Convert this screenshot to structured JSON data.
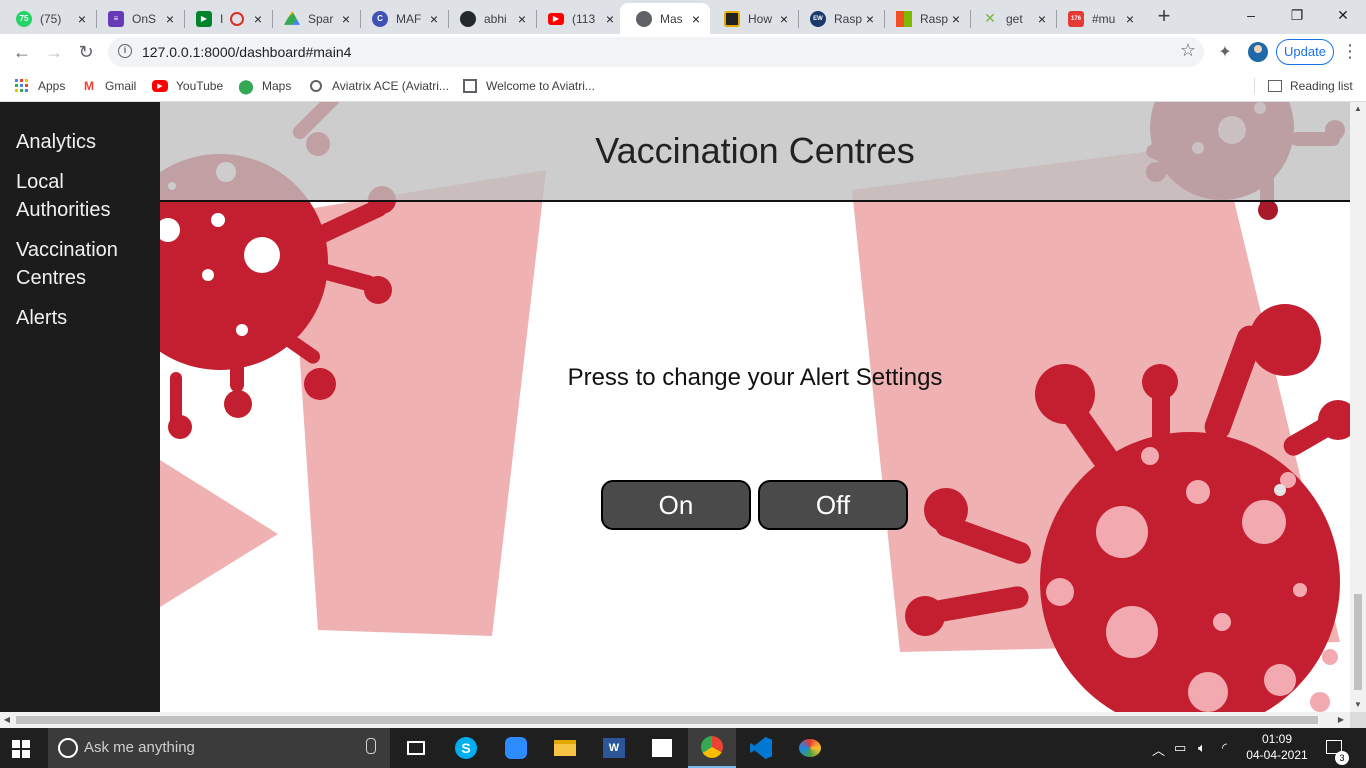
{
  "browser": {
    "tabs": [
      {
        "title": "(75)",
        "icon": "whatsapp-icon",
        "color": "#25d366",
        "badge": "75"
      },
      {
        "title": "OnS",
        "icon": "forms-icon",
        "color": "#673ab7",
        "badge": ""
      },
      {
        "title": "I",
        "icon": "meet-icon",
        "color": "#00832d",
        "badge": ""
      },
      {
        "title": "Spar",
        "icon": "drive-icon",
        "color": "#fbbc04",
        "badge": ""
      },
      {
        "title": "MAF",
        "icon": "c-icon",
        "color": "#3f51b5",
        "badge": "C"
      },
      {
        "title": "abhi",
        "icon": "github-icon",
        "color": "#24292e",
        "badge": ""
      },
      {
        "title": "(113",
        "icon": "youtube-icon",
        "color": "#ff0000",
        "badge": ""
      },
      {
        "title": "Mas",
        "icon": "globe-icon",
        "color": "#5f6368",
        "badge": ""
      },
      {
        "title": "How",
        "icon": "howto-icon",
        "color": "#e0a800",
        "badge": ""
      },
      {
        "title": "Rasp",
        "icon": "ew-icon",
        "color": "#1b3a6b",
        "badge": "EW"
      },
      {
        "title": "Rasp",
        "icon": "microsoft-icon",
        "color": "#f25022",
        "badge": ""
      },
      {
        "title": "get",
        "icon": "stackshare-icon",
        "color": "#7cb342",
        "badge": ""
      },
      {
        "title": "#mu",
        "icon": "calendar-icon",
        "color": "#e53935",
        "badge": "176"
      }
    ],
    "window_controls": {
      "minimize": "–",
      "restore": "❐",
      "close": "✕"
    },
    "new_tab": "+",
    "url": "127.0.0.1:8000/dashboard#main4",
    "update_label": "Update",
    "bookmarks": [
      {
        "label": "Apps",
        "icon": "apps-grid-icon"
      },
      {
        "label": "Gmail",
        "icon": "gmail-icon"
      },
      {
        "label": "YouTube",
        "icon": "youtube-icon"
      },
      {
        "label": "Maps",
        "icon": "maps-pin-icon"
      },
      {
        "label": "Aviatrix ACE (Aviatri...",
        "icon": "globe-icon"
      },
      {
        "label": "Welcome to Aviatri...",
        "icon": "page-icon"
      }
    ],
    "reading_list": "Reading list"
  },
  "sidebar": {
    "items": [
      {
        "label": "Analytics"
      },
      {
        "label": "Local Authorities"
      },
      {
        "label": "Vaccination Centres"
      },
      {
        "label": "Alerts"
      }
    ]
  },
  "main": {
    "title": "Vaccination Centres",
    "prompt": "Press to change your Alert Settings",
    "on_label": "On",
    "off_label": "Off"
  },
  "taskbar": {
    "search_placeholder": "Ask me anything",
    "apps": [
      "task-view-icon",
      "skype-icon",
      "zoom-icon",
      "file-explorer-icon",
      "word-icon",
      "store-icon",
      "chrome-icon",
      "vscode-icon",
      "paint-icon"
    ],
    "time": "01:09",
    "date": "04-04-2021",
    "notifications": "3"
  },
  "colors": {
    "sidebar_bg": "#1c1c1c",
    "virus_red": "#c41f30",
    "pink_shape": "#efb1b1",
    "button_bg": "#4a4a4a"
  }
}
